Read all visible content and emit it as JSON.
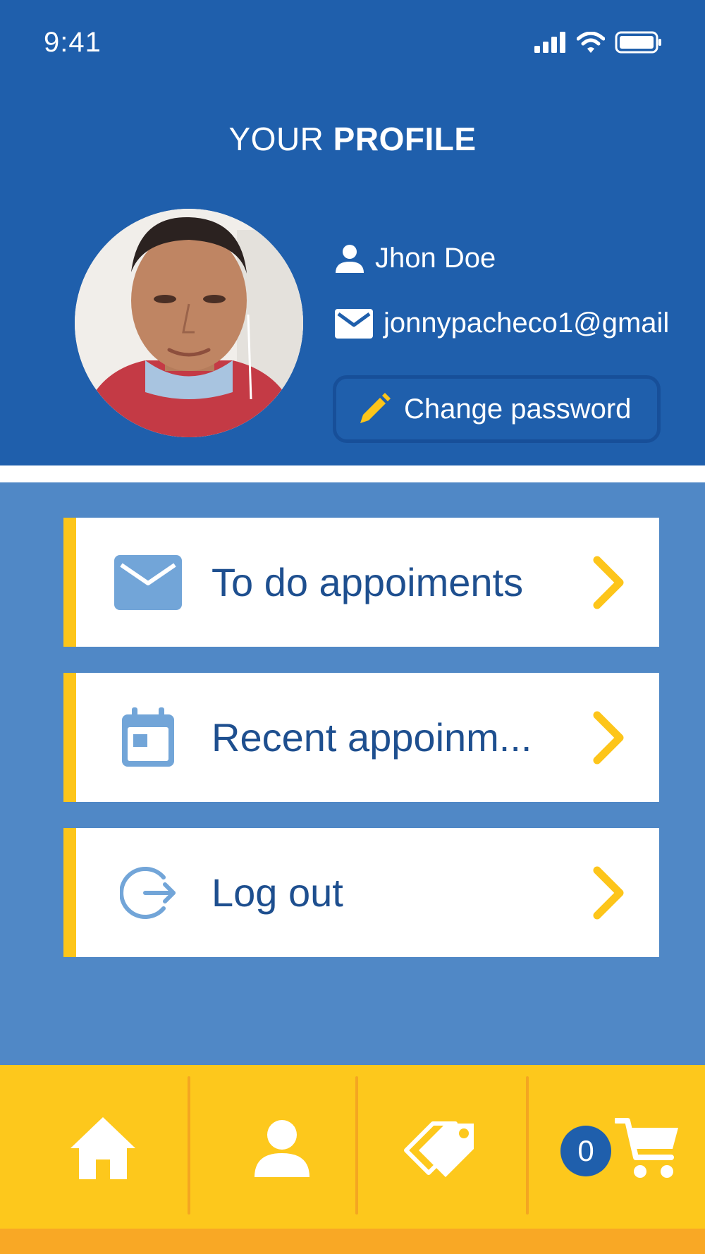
{
  "status_bar": {
    "time": "9:41",
    "icons": [
      "signal-icon",
      "wifi-icon",
      "battery-icon"
    ]
  },
  "header": {
    "title_light": "YOUR",
    "title_bold": "PROFILE"
  },
  "profile": {
    "name": "Jhon Doe",
    "email": "jonnypacheco1@gmail",
    "change_password_label": "Change password"
  },
  "menu": {
    "items": [
      {
        "label": "To do appoiments",
        "icon": "mail-icon"
      },
      {
        "label": "Recent appoinm...",
        "icon": "calendar-icon"
      },
      {
        "label": "Log out",
        "icon": "logout-icon"
      }
    ]
  },
  "bottom_nav": {
    "items": [
      "home-icon",
      "user-icon",
      "tags-icon",
      "cart-icon"
    ],
    "cart_count": "0"
  },
  "colors": {
    "primary_blue": "#1f5fac",
    "content_blue": "#5088c6",
    "accent_yellow": "#fdc51a",
    "text_blue": "#1e4f8f",
    "icon_light_blue": "#72a5d8"
  }
}
